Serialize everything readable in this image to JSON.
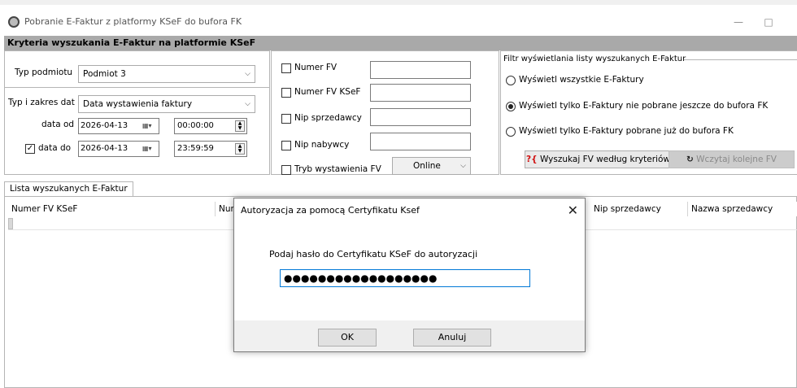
{
  "window": {
    "title": "Pobranie E-Faktur z platformy KSeF do bufora FK",
    "minimize": "—",
    "maximize": "□"
  },
  "criteria": {
    "header": "Kryteria wyszukania E-Faktur na platformie KSeF",
    "entity_type_label": "Typ podmiotu",
    "entity_type_value": "Podmiot 3",
    "date_type_label": "Typ i zakres dat",
    "date_type_value": "Data wystawienia faktury",
    "date_from_label": "data od",
    "date_from": "2026-04-13",
    "time_from": "00:00:00",
    "date_to_label": "data do",
    "date_to_checked": true,
    "date_to": "2026-04-13",
    "time_to": "23:59:59",
    "fields": {
      "numer_fv": "Numer FV",
      "numer_fv_ksef": "Numer FV KSeF",
      "nip_sprzedawcy": "Nip sprzedawcy",
      "nip_nabywcy": "Nip nabywcy",
      "tryb_wystawienia": "Tryb wystawienia FV",
      "tryb_value": "Online"
    }
  },
  "filter": {
    "legend": "Filtr wyświetlania listy wyszukanych E-Faktur",
    "options": [
      "Wyświetl wszystkie E-Faktury",
      "Wyświetl tylko E-Faktury nie pobrane jeszcze do bufora FK",
      "Wyświetl tylko E-Faktury pobrane już do bufora FK"
    ],
    "selected_index": 1,
    "search_button": "Wyszukaj FV według kryteriów",
    "load_more_button": "Wczytaj kolejne FV"
  },
  "list": {
    "tab_label": "Lista wyszukanych E-Faktur",
    "columns": [
      "Numer FV KSeF",
      "Num",
      "Nip sprzedawcy",
      "Nazwa sprzedawcy"
    ]
  },
  "dialog": {
    "title": "Autoryzacja za pomocą Certyfikatu Ksef",
    "close": "✕",
    "message": "Podaj hasło do Certyfikatu KSeF do autoryzacji",
    "password_mask": "●●●●●●●●●●●●●●●●●●",
    "ok_label": "OK",
    "cancel_label": "Anuluj"
  },
  "icons": {
    "search_icon_text": "?{",
    "search_icon_color": "#d01010"
  }
}
